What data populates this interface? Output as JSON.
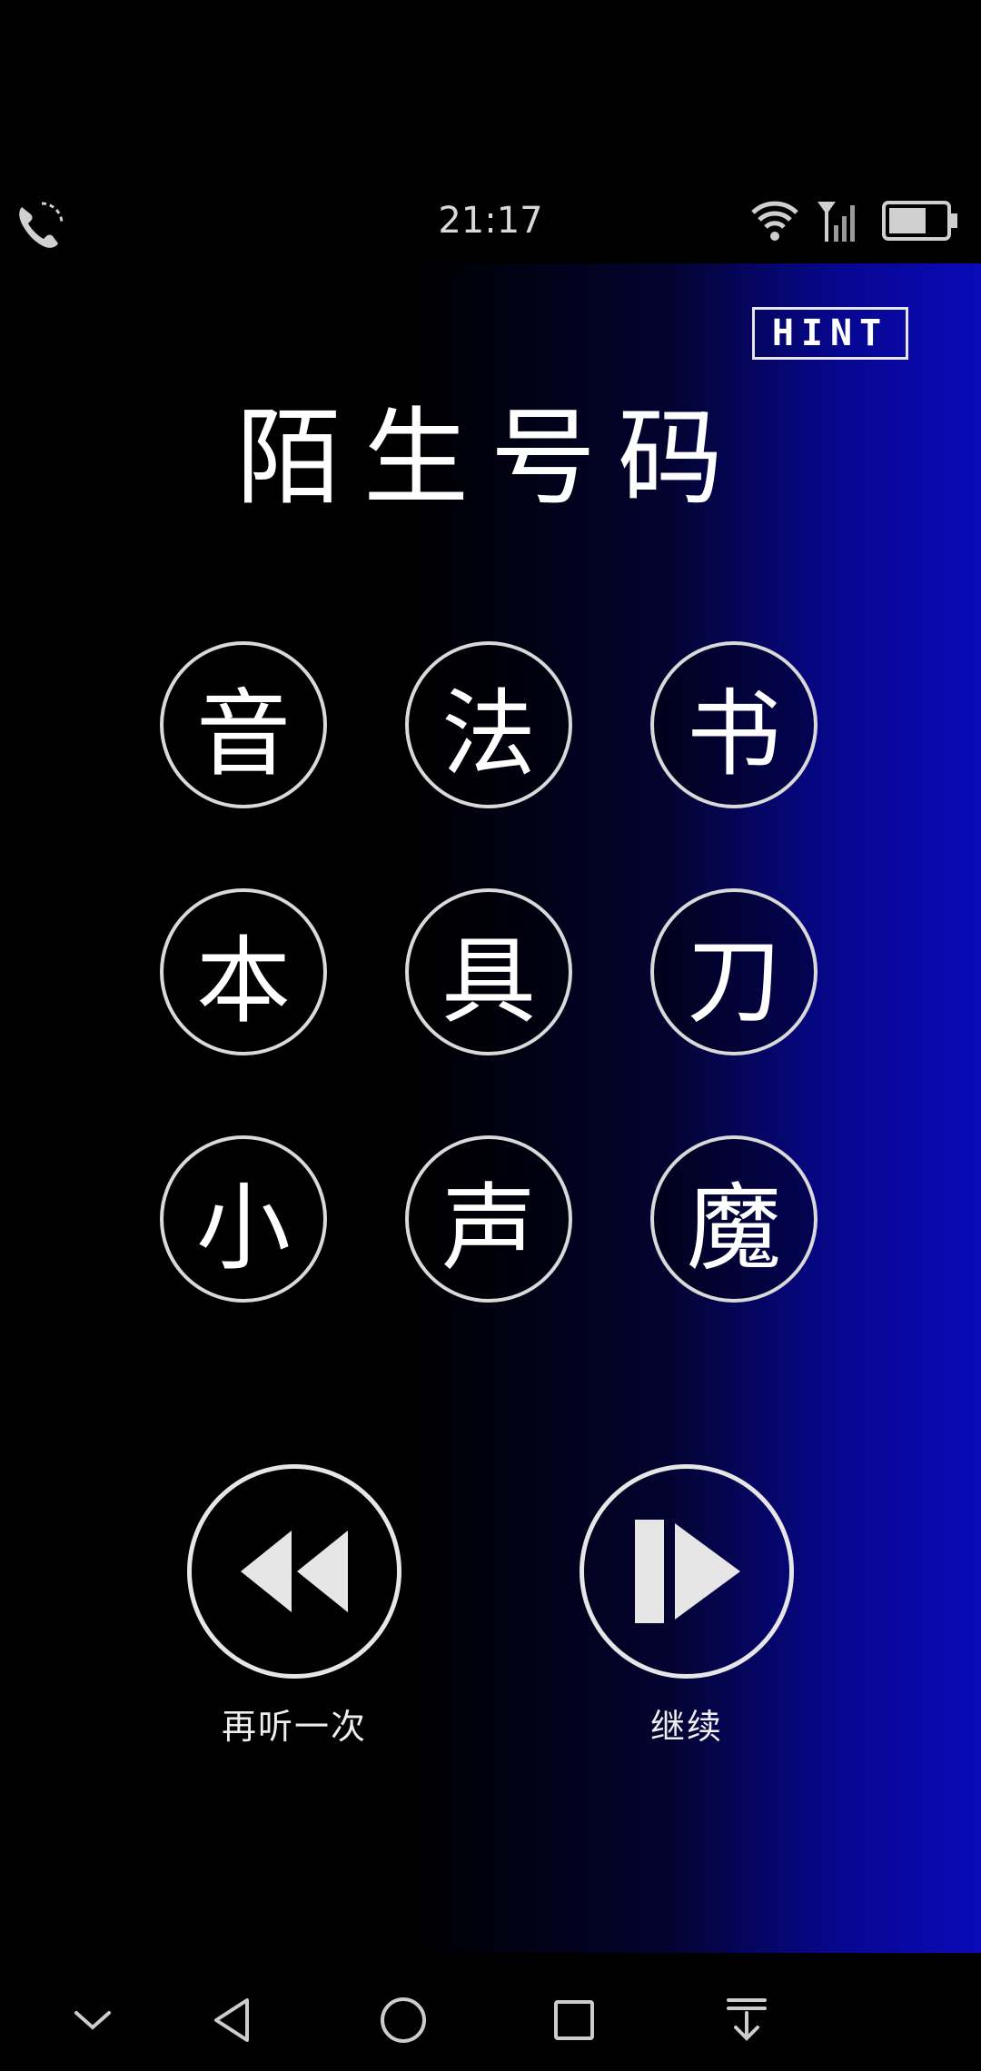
{
  "status_bar": {
    "time": "21:17",
    "icons": [
      "phone-call-icon",
      "wifi-icon",
      "signal-icon",
      "battery-icon"
    ]
  },
  "game": {
    "hint_label": "HINT",
    "title": "陌生号码",
    "characters": [
      "音",
      "法",
      "书",
      "本",
      "具",
      "刀",
      "小",
      "声",
      "魔"
    ],
    "replay": {
      "label": "再听一次",
      "icon": "rewind-icon"
    },
    "continue": {
      "label": "继续",
      "icon": "play-next-icon"
    }
  },
  "nav_bar": {
    "icons": [
      "collapse-chevron-icon",
      "back-icon",
      "home-icon",
      "recents-icon",
      "notification-pull-icon"
    ]
  },
  "colors": {
    "background": "#000000",
    "gradient_accent": "#0a0ab8",
    "foreground": "#ffffff",
    "outline": "#d9d9d9"
  }
}
